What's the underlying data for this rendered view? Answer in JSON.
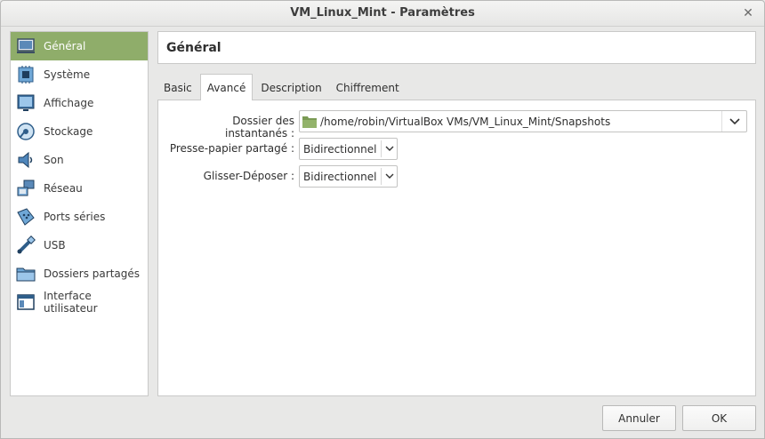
{
  "window": {
    "title": "VM_Linux_Mint - Paramètres"
  },
  "sidebar": {
    "items": [
      {
        "label": "Général",
        "icon": "general-icon",
        "selected": true
      },
      {
        "label": "Système",
        "icon": "system-icon"
      },
      {
        "label": "Affichage",
        "icon": "display-icon"
      },
      {
        "label": "Stockage",
        "icon": "storage-icon"
      },
      {
        "label": "Son",
        "icon": "audio-icon"
      },
      {
        "label": "Réseau",
        "icon": "network-icon"
      },
      {
        "label": "Ports séries",
        "icon": "serial-ports-icon"
      },
      {
        "label": "USB",
        "icon": "usb-icon"
      },
      {
        "label": "Dossiers partagés",
        "icon": "shared-folders-icon"
      },
      {
        "label": "Interface utilisateur",
        "icon": "user-interface-icon"
      }
    ]
  },
  "header": {
    "title": "Général"
  },
  "tabs": [
    {
      "label": "Basic",
      "active": false
    },
    {
      "label": "Avancé",
      "active": true
    },
    {
      "label": "Description",
      "active": false
    },
    {
      "label": "Chiffrement",
      "active": false
    }
  ],
  "form": {
    "snapshot_label": "Dossier des instantanés :",
    "snapshot_path": "/home/robin/VirtualBox VMs/VM_Linux_Mint/Snapshots",
    "clipboard_label": "Presse-papier partagé :",
    "clipboard_value": "Bidirectionnel",
    "dragdrop_label": "Glisser-Déposer :",
    "dragdrop_value": "Bidirectionnel"
  },
  "buttons": {
    "cancel": "Annuler",
    "ok": "OK"
  },
  "colors": {
    "selected_bg": "#8fad6a",
    "panel_bg": "#ffffff",
    "window_bg": "#e8e8e7"
  }
}
